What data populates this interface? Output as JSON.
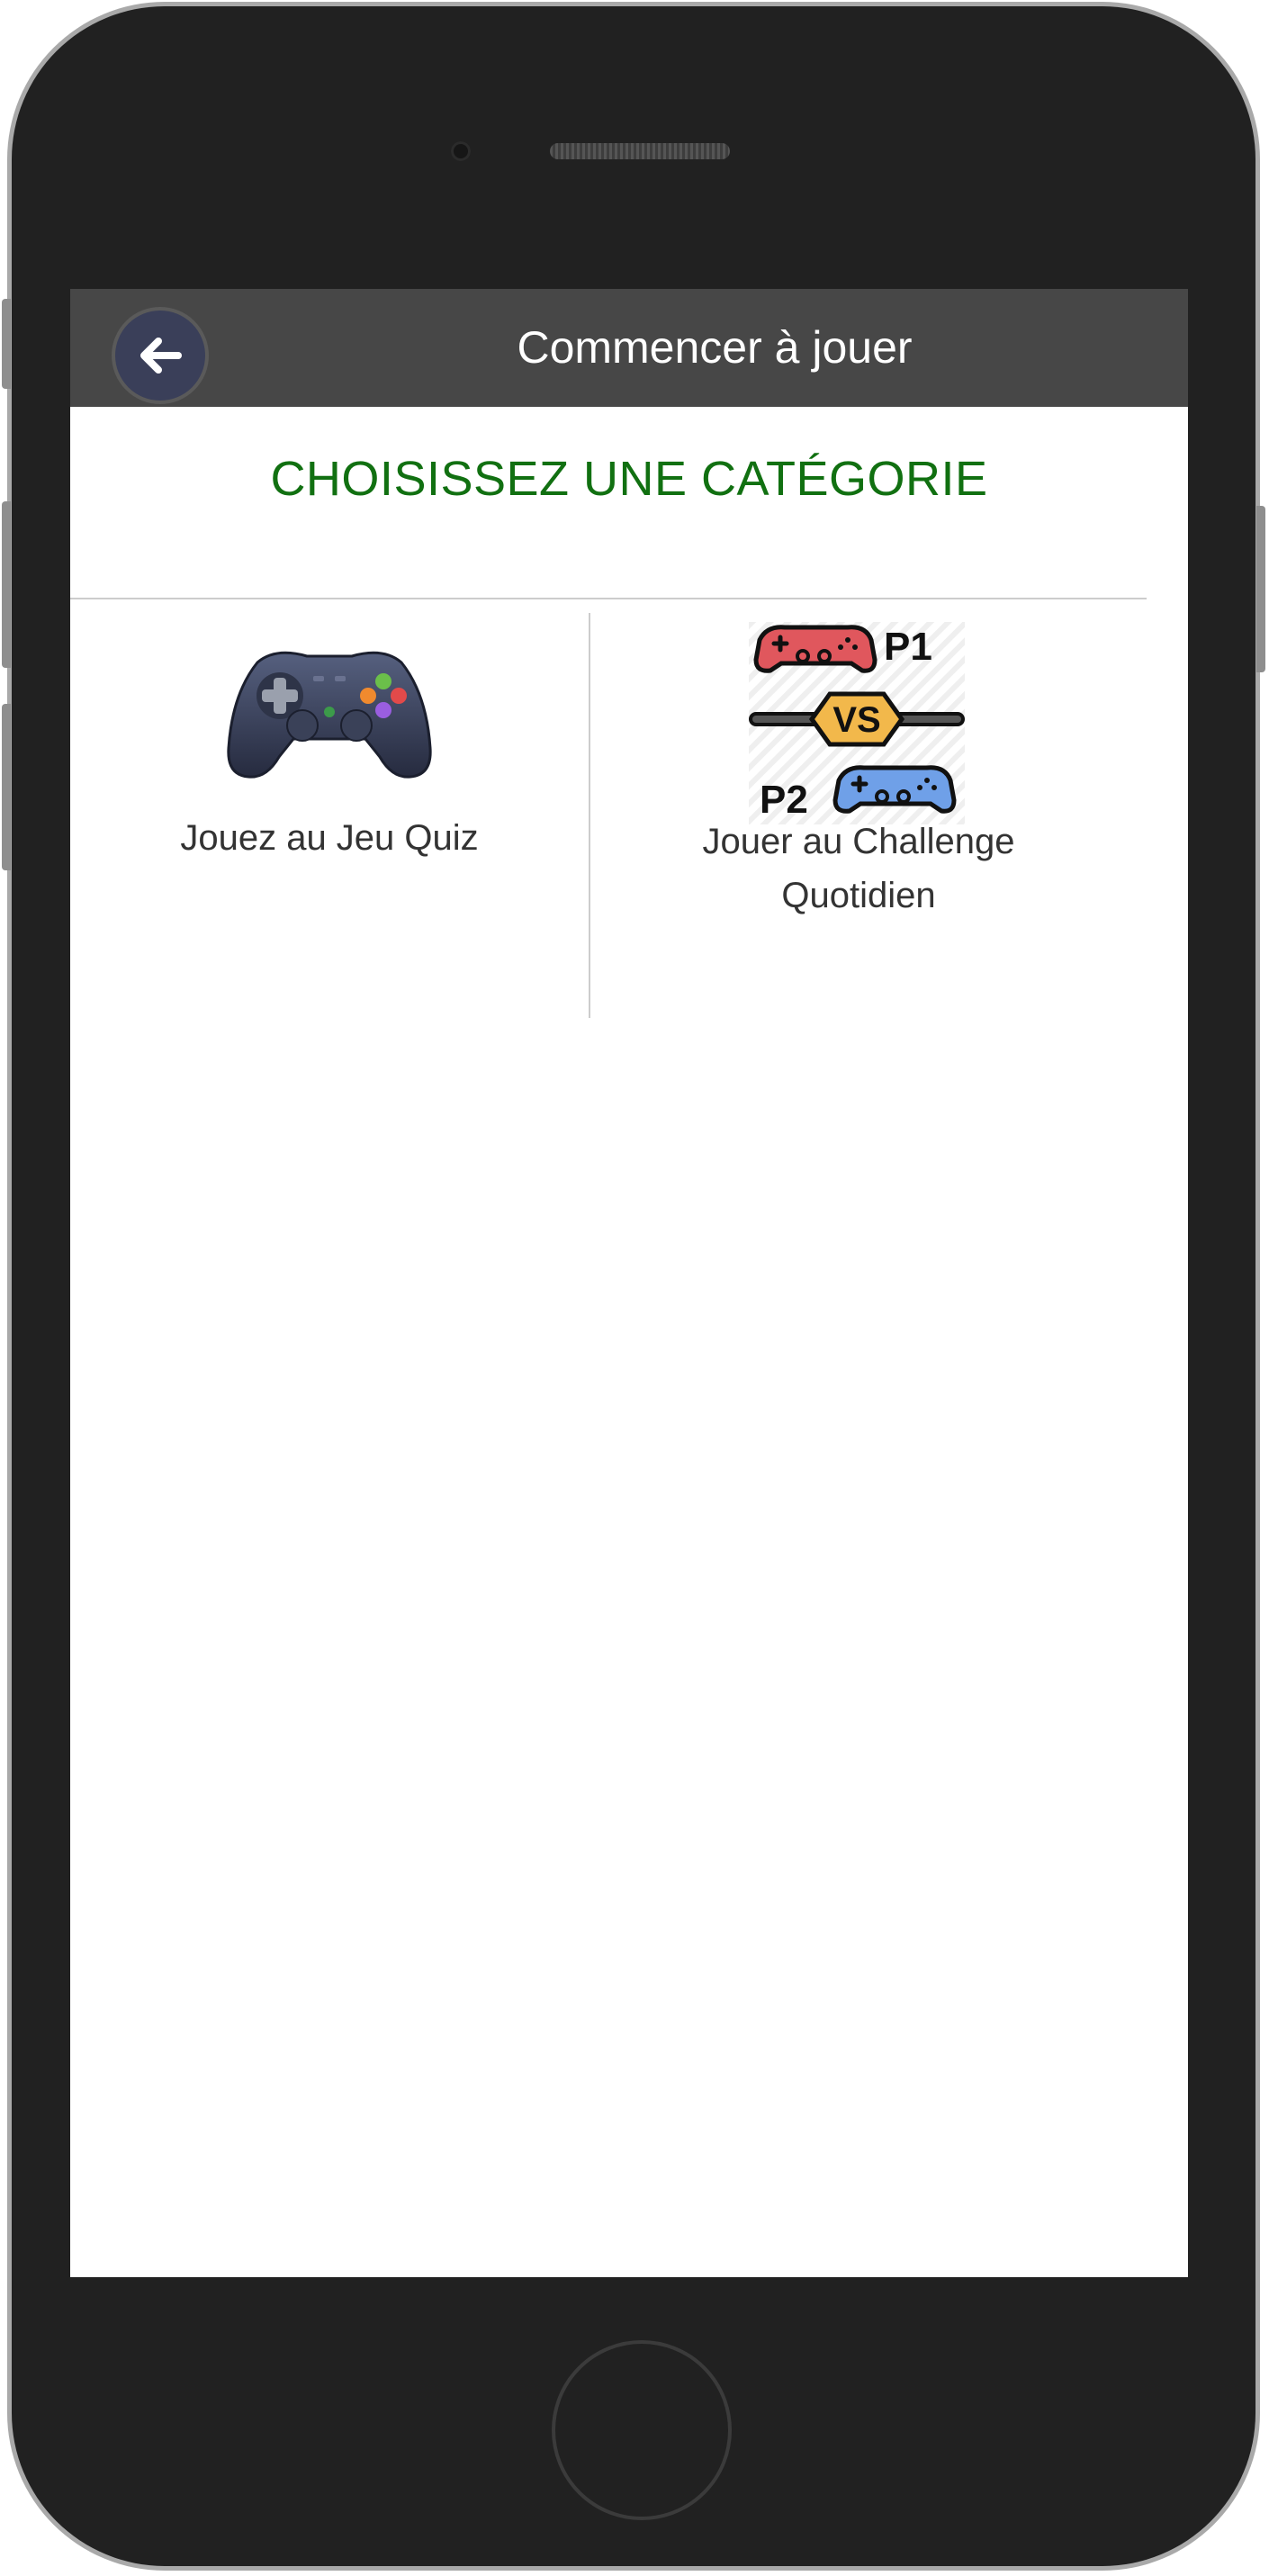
{
  "header": {
    "title": "Commencer à jouer",
    "back_icon": "arrow-left-icon"
  },
  "main": {
    "heading": "CHOISISSEZ UNE CATÉGORIE",
    "categories": [
      {
        "label": "Jouez au Jeu Quiz",
        "icon": "gamepad-icon"
      },
      {
        "label": "Jouer au Challenge Quotidien",
        "icon": "versus-controllers-icon",
        "badges": [
          "P1",
          "VS",
          "P2"
        ]
      }
    ]
  },
  "colors": {
    "appbar": "#474747",
    "heading": "#117011",
    "phone_body": "#212121"
  }
}
